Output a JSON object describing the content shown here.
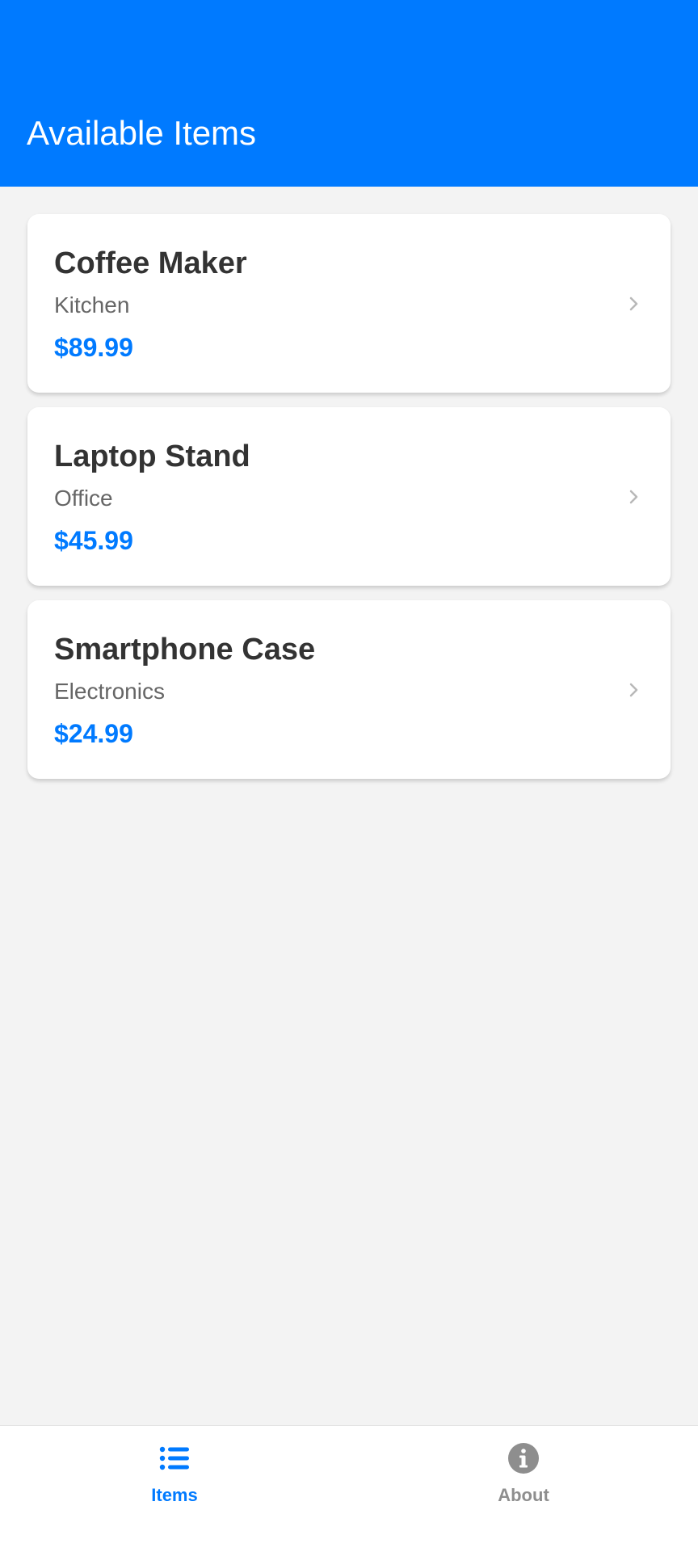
{
  "header": {
    "title": "Available Items",
    "background_color": "#007aff"
  },
  "items": [
    {
      "name": "Coffee Maker",
      "category": "Kitchen",
      "price": "$89.99"
    },
    {
      "name": "Laptop Stand",
      "category": "Office",
      "price": "$45.99"
    },
    {
      "name": "Smartphone Case",
      "category": "Electronics",
      "price": "$24.99"
    }
  ],
  "item_chevron_icon": "chevron-right-icon",
  "tab_bar": {
    "tabs": [
      {
        "label": "Items",
        "icon": "list-icon",
        "active": true,
        "color": "#007aff"
      },
      {
        "label": "About",
        "icon": "info-icon",
        "active": false,
        "color": "#8e8e8e"
      }
    ]
  },
  "colors": {
    "accent": "#007aff",
    "background": "#f3f3f3",
    "card": "#ffffff",
    "title_text": "#333333",
    "secondary_text": "#666666",
    "inactive_tab": "#8e8e8e"
  }
}
